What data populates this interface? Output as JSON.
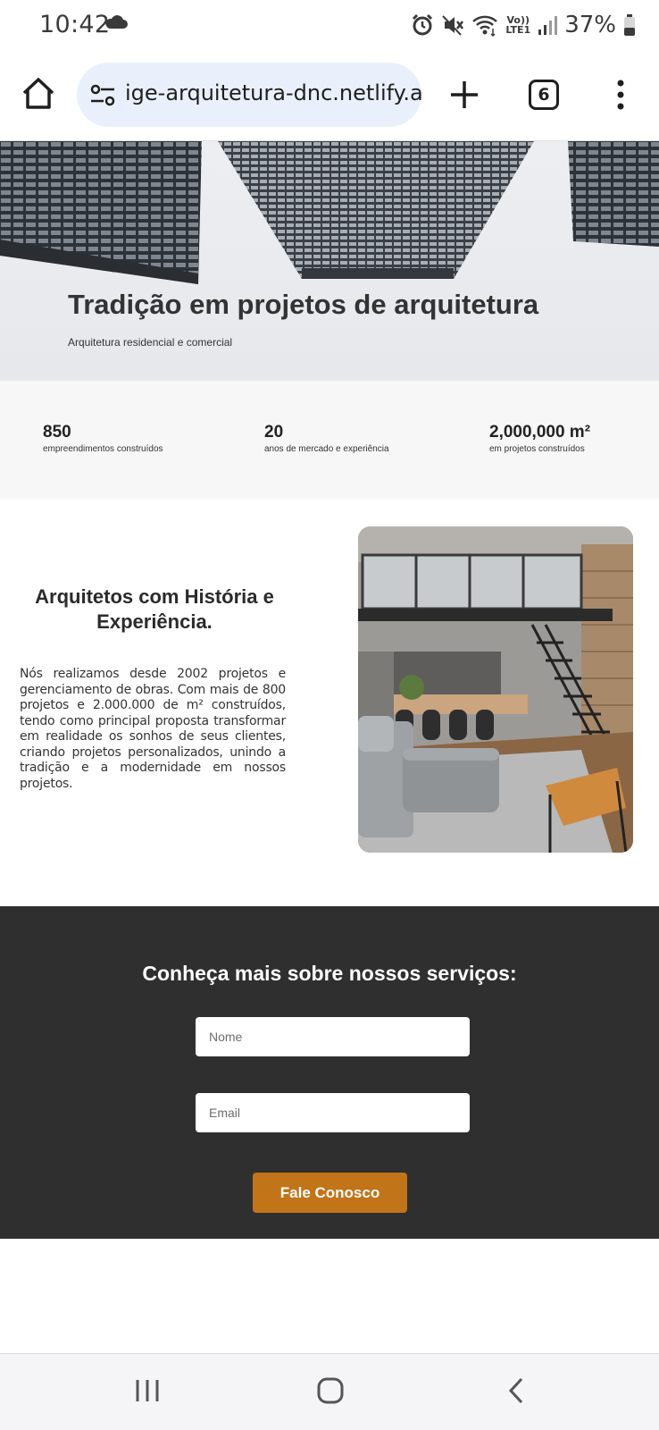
{
  "status_bar": {
    "time": "10:42",
    "battery": "37%",
    "network_label_top": "Vo))",
    "network_label_bottom": "LTE1"
  },
  "browser": {
    "url": "ige-arquitetura-dnc.netlify.app",
    "tab_count": "6"
  },
  "hero": {
    "title": "Tradição em projetos de arquitetura",
    "subtitle": "Arquitetura residencial e comercial"
  },
  "stats": [
    {
      "value": "850",
      "label": "empreendimentos construídos"
    },
    {
      "value": "20",
      "label": "anos de mercado e experiência"
    },
    {
      "value": "2,000,000 m²",
      "label": "em projetos construídos"
    }
  ],
  "about": {
    "title": "Arquitetos com História e Experiência.",
    "text": "Nós realizamos desde 2002 projetos e gerenciamento de obras. Com mais de 800 projetos e 2.000.000 de m² construídos, tendo como principal proposta transformar em realidade os sonhos de seus clientes, criando projetos personalizados, unindo a tradição e a modernidade em nossos projetos."
  },
  "contact": {
    "title": "Conheça mais sobre nossos serviços:",
    "name_placeholder": "Nome",
    "email_placeholder": "Email",
    "button_label": "Fale Conosco"
  },
  "colors": {
    "accent": "#c27419",
    "contact_bg": "#2f2f2f",
    "url_bar_bg": "#eaf0fb",
    "stats_bg": "#f7f7f7"
  },
  "icons": {
    "status": [
      "cloud-icon",
      "alarm-icon",
      "mute-icon",
      "wifi-icon",
      "signal-icon",
      "battery-icon"
    ],
    "toolbar": [
      "home-icon",
      "site-settings-icon",
      "plus-icon",
      "tabs-icon",
      "more-vert-icon"
    ],
    "navigation": [
      "recent-apps-icon",
      "home-nav-icon",
      "back-icon"
    ]
  }
}
